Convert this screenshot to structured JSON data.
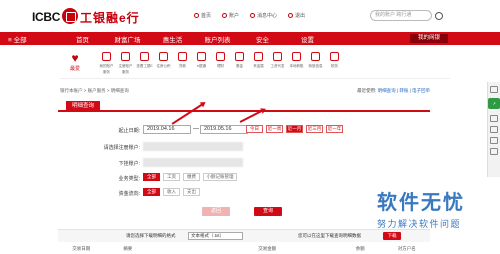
{
  "header": {
    "logo_en": "ICBC",
    "logo_cn": "工银融e行",
    "links": [
      "首页",
      "账户",
      "消息中心",
      "退出"
    ],
    "search_placeholder": "我的账户 跨行通"
  },
  "nav": {
    "items": [
      "全部",
      "首页",
      "财富广场",
      "惠生活",
      "账户列表",
      "安全",
      "设置"
    ],
    "my_label": "我的网银"
  },
  "quick": {
    "main_label": "最爱",
    "items": [
      "我的账户服务",
      "注册账户服务",
      "查看工银E",
      "住房公积",
      "贷款",
      "e银通",
      "理财",
      "基金",
      "贵金属",
      "工资代发",
      "本地转账",
      "商旅信息",
      "税务"
    ]
  },
  "breadcrumb": "银行本账户 > 账户服务 > 明细查询",
  "top_right": {
    "prefix": "最近使用:",
    "links": [
      "明细查询",
      "转账",
      "电子回单"
    ]
  },
  "tab_label": "明细查询",
  "form": {
    "date_label": "起止日期:",
    "start_date": "2019.04.16",
    "end_date": "2019.05.16",
    "date_separator": "—",
    "quick_ranges": [
      "今日",
      "近一周",
      "近一月",
      "近三月",
      "近一年"
    ],
    "account_label": "请选择注册账户:",
    "sub_account_label": "下挂账户:",
    "type_label": "业务类型:",
    "type_options": [
      "全部",
      "工资",
      "缴费",
      "小额记账管理"
    ],
    "direction_label": "资金流向:",
    "direction_options": [
      "全部",
      "收入",
      "支出"
    ],
    "reset": "返回",
    "query": "查询"
  },
  "bottom": {
    "format_text": "请您选择下载明细的格式",
    "format_value": "文本格式（.txt）",
    "hint_text": "您可以在这里下载查询明细数据",
    "download": "下载"
  },
  "table_headers": [
    "交易日期",
    "摘要",
    "",
    "",
    "交易金额",
    "",
    "余额",
    "对方户名"
  ],
  "watermark": {
    "title": "软件无忧",
    "subtitle": "努力解决软件问题"
  },
  "colors": {
    "brand": "#d20a16",
    "watermark": "#3a78c0"
  }
}
